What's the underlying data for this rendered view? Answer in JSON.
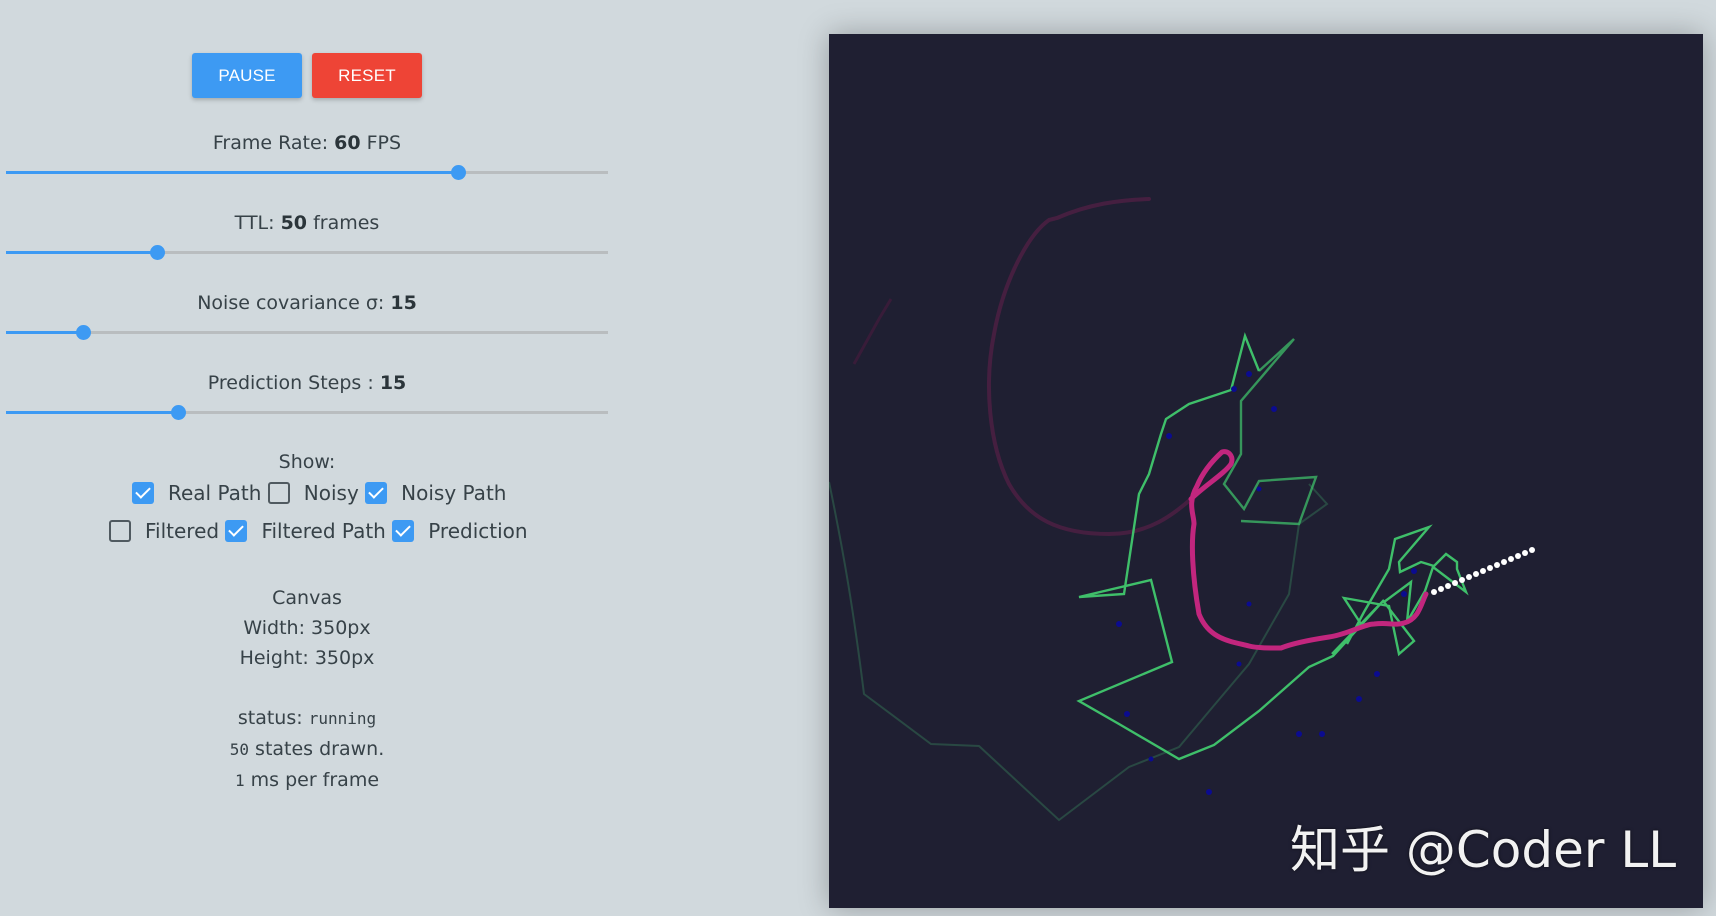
{
  "buttons": {
    "pause": "PAUSE",
    "reset": "RESET"
  },
  "sliders": {
    "frame_rate": {
      "label": "Frame Rate: ",
      "value": "60",
      "unit": " FPS",
      "fraction": 0.75
    },
    "ttl": {
      "label": "TTL: ",
      "value": "50",
      "unit": " frames",
      "fraction": 0.25
    },
    "noise": {
      "label": "Noise covariance σ: ",
      "value": "15",
      "unit": "",
      "fraction": 0.128
    },
    "prediction": {
      "label": "Prediction Steps : ",
      "value": "15",
      "unit": "",
      "fraction": 0.285
    }
  },
  "show": {
    "title": "Show:",
    "options": [
      {
        "label": "Real Path",
        "checked": true
      },
      {
        "label": "Noisy",
        "checked": false
      },
      {
        "label": "Noisy Path",
        "checked": true
      },
      {
        "label": "Filtered",
        "checked": false
      },
      {
        "label": "Filtered Path",
        "checked": true
      },
      {
        "label": "Prediction",
        "checked": true
      }
    ]
  },
  "canvas_info": {
    "title": "Canvas",
    "width": "Width: 350px",
    "height": "Height: 350px"
  },
  "status": {
    "label": "status: ",
    "value": "running",
    "states_count": "50",
    "states_text": " states drawn.",
    "ms_count": "1",
    "ms_text": " ms per frame"
  },
  "colors": {
    "accent": "#3d9af3",
    "reset": "#ee4436",
    "canvas_bg": "#1f1f32",
    "real_path": "#c2267e",
    "noisy_path": "#3fbf6a",
    "prediction": "#ffffff"
  },
  "watermark": "知乎 @Coder LL"
}
